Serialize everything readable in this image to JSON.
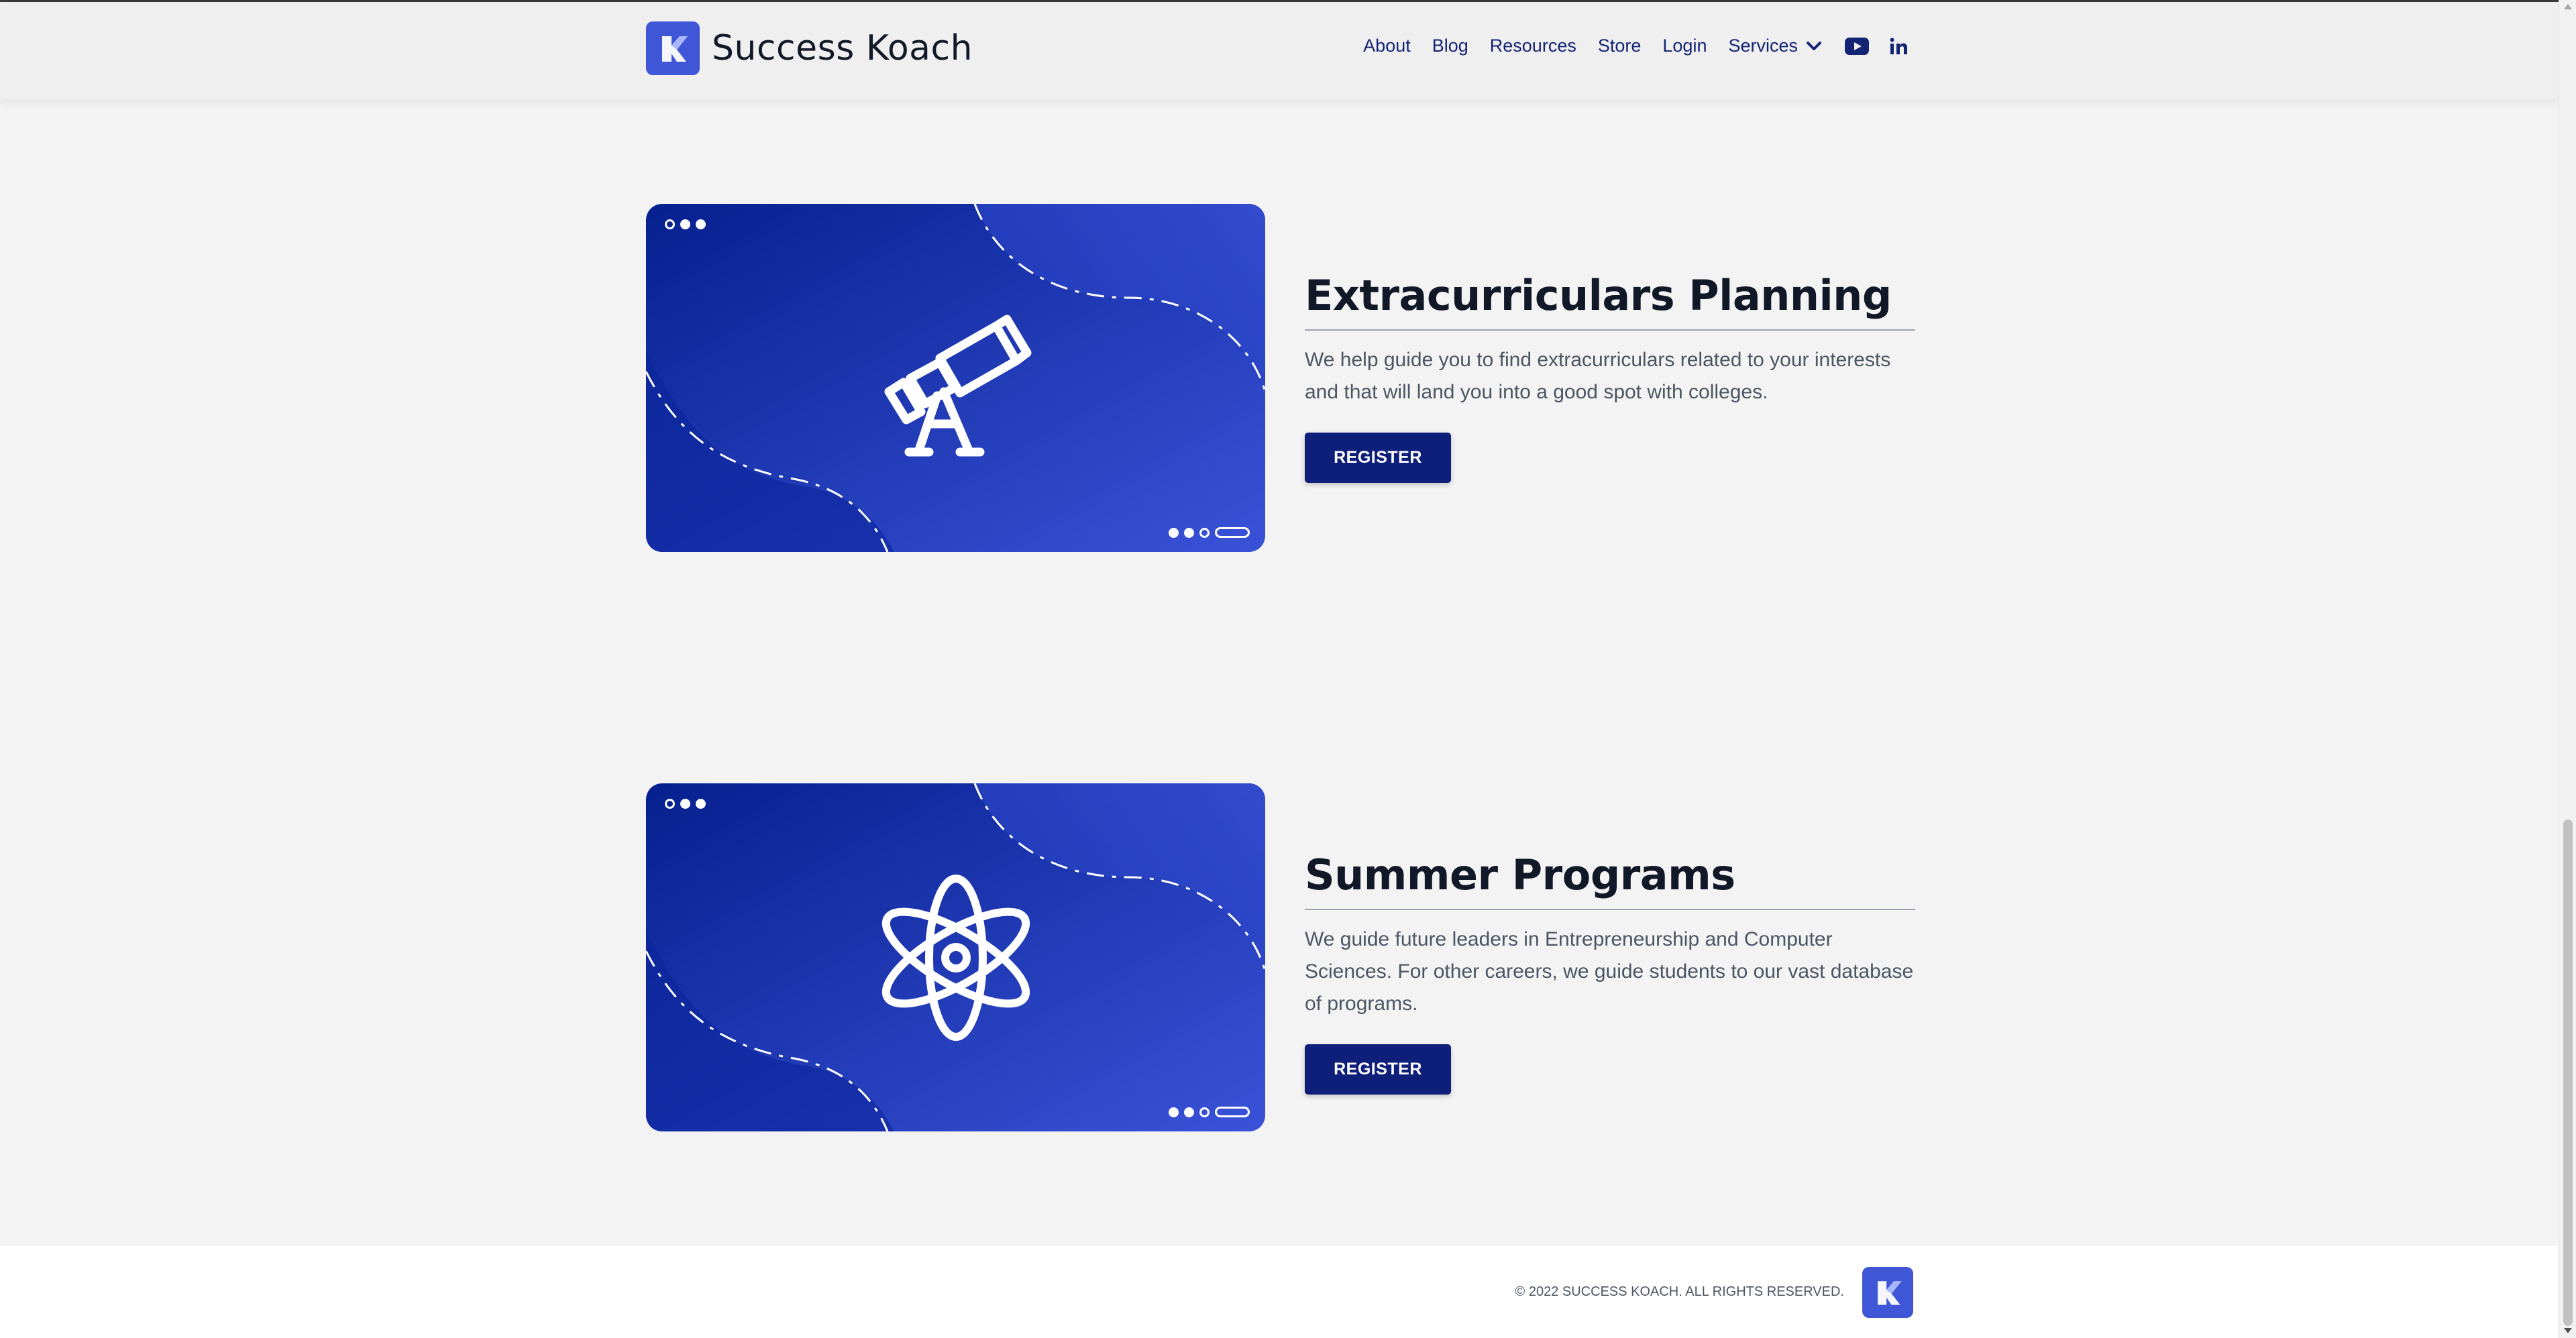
{
  "header": {
    "brand_name": "Success Koach",
    "nav": [
      "About",
      "Blog",
      "Resources",
      "Store",
      "Login"
    ],
    "services_label": "Services"
  },
  "sections": [
    {
      "title": "Extracurriculars Planning",
      "description": "We help guide you to find extracurriculars related to your interests and that will land you into a good spot with colleges.",
      "button_label": "REGISTER",
      "icon": "telescope-icon"
    },
    {
      "title": "Summer Programs",
      "description": "We guide future leaders in Entrepreneurship and Computer Sciences. For other careers, we guide students to our vast database of programs.",
      "button_label": "REGISTER",
      "icon": "atom-icon"
    }
  ],
  "footer": {
    "copyright": "© 2022 SUCCESS KOACH. ALL RIGHTS RESERVED."
  },
  "colors": {
    "brand_blue": "#3f57d6",
    "navy": "#0e1f7a",
    "nav_text": "#142475",
    "card_dark": "#0a1f8f",
    "card_light": "#3a52d8"
  }
}
